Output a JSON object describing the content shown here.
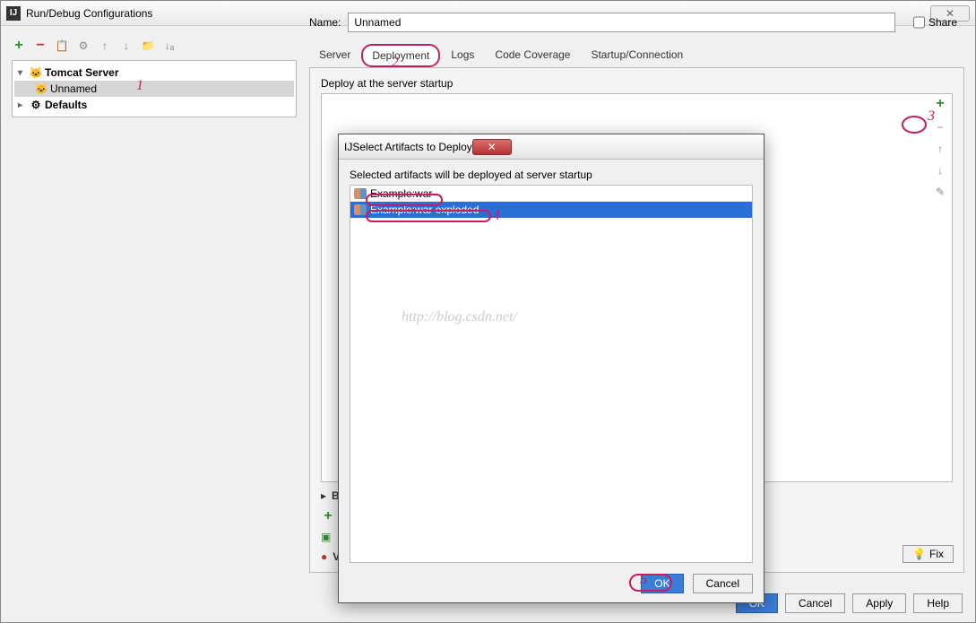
{
  "window": {
    "title": "Run/Debug Configurations"
  },
  "tree": {
    "root1": "Tomcat Server",
    "child1": "Unnamed",
    "root2": "Defaults"
  },
  "name": {
    "label": "Name:",
    "value": "Unnamed"
  },
  "share": {
    "label": "Share"
  },
  "tabs": {
    "server": "Server",
    "deployment": "Deployment",
    "logs": "Logs",
    "coverage": "Code Coverage",
    "startup": "Startup/Connection"
  },
  "deploy": {
    "label": "Deploy at the server startup"
  },
  "bottom": {
    "before_launch": "B",
    "warning": "V"
  },
  "fix": {
    "label": "Fix"
  },
  "footer": {
    "ok": "OK",
    "cancel": "Cancel",
    "apply": "Apply",
    "help": "Help"
  },
  "dialog": {
    "title": "Select Artifacts to Deploy",
    "subtitle": "Selected artifacts will be deployed at server startup",
    "item1": "Example:war",
    "item2": "Example:war exploded",
    "ok": "OK",
    "cancel": "Cancel"
  },
  "watermark": "http://blog.csdn.net/",
  "annotations": {
    "a1": "1",
    "a2": "2",
    "a3": "3",
    "a4": "4",
    "a5": "5"
  }
}
